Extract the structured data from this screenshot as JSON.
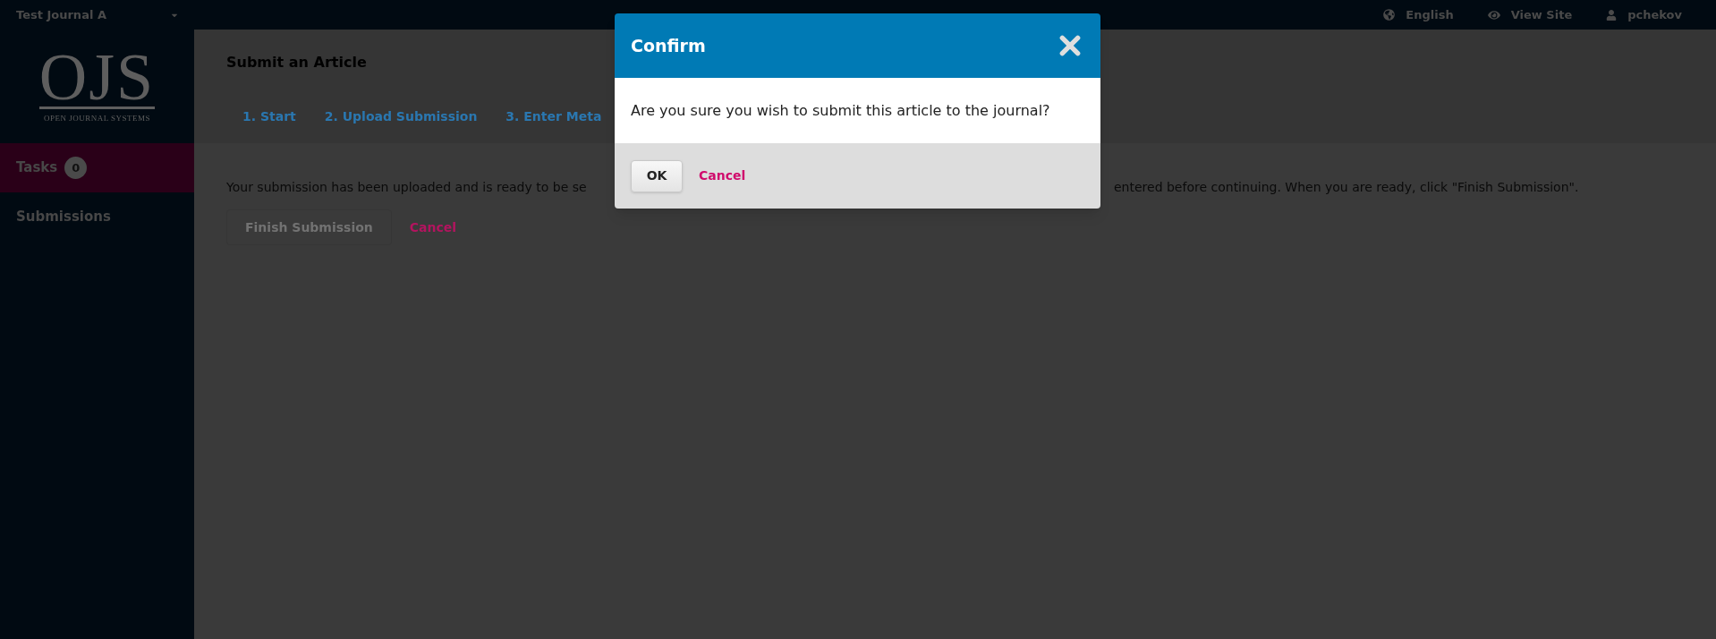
{
  "top_bar": {
    "journal": "Test Journal A",
    "links": [
      {
        "kind": "language",
        "label": "English"
      },
      {
        "kind": "view",
        "label": "View Site"
      },
      {
        "kind": "user",
        "label": "pchekov"
      }
    ]
  },
  "logo": {
    "mark": "OJS",
    "tagline": "OPEN JOURNAL SYSTEMS"
  },
  "sidebar": {
    "items": [
      {
        "label": "Tasks",
        "badge": "0",
        "selected": true
      },
      {
        "label": "Submissions",
        "selected": false
      }
    ]
  },
  "page": {
    "title": "Submit an Article",
    "tabs": [
      {
        "label": "1. Start"
      },
      {
        "label": "2. Upload Submission"
      },
      {
        "label": "3. Enter Meta"
      }
    ],
    "message_parts": [
      "Your submission has been uploaded and is ready to be se",
      "entered before continuing. When you are ready, click \"Finish Submission\"."
    ],
    "buttons": [
      {
        "kind": "primary",
        "label": "Finish Submission"
      },
      {
        "kind": "link",
        "label": "Cancel"
      }
    ]
  },
  "dialog": {
    "title": "Confirm",
    "message": "Are you sure you wish to submit this article to the journal?",
    "buttons": [
      {
        "kind": "primary",
        "label": "OK"
      },
      {
        "kind": "link",
        "label": "Cancel"
      }
    ]
  }
}
